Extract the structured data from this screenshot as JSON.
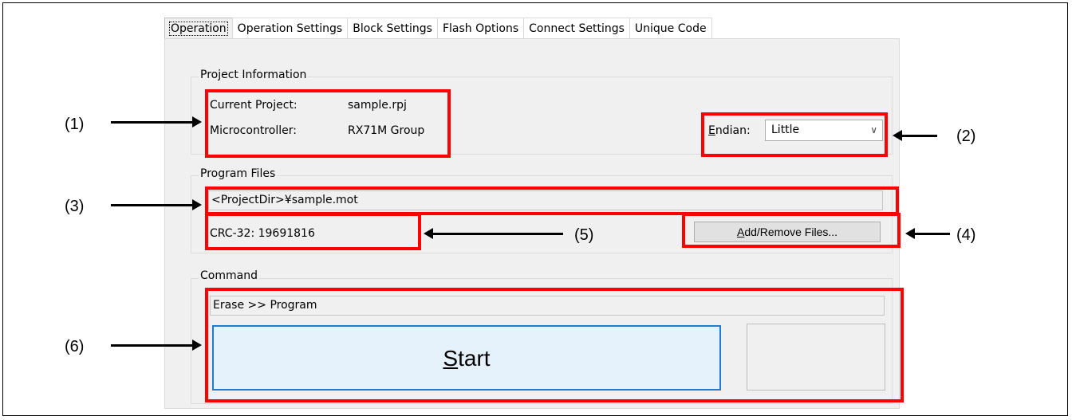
{
  "tabs": [
    {
      "label": "Operation",
      "active": true
    },
    {
      "label": "Operation Settings",
      "active": false
    },
    {
      "label": "Block Settings",
      "active": false
    },
    {
      "label": "Flash Options",
      "active": false
    },
    {
      "label": "Connect Settings",
      "active": false
    },
    {
      "label": "Unique Code",
      "active": false
    }
  ],
  "project_info": {
    "title": "Project Information",
    "current_project_label": "Current Project:",
    "current_project_value": "sample.rpj",
    "microcontroller_label": "Microcontroller:",
    "microcontroller_value": "RX71M Group",
    "endian_label_mnemonic": "E",
    "endian_label_rest": "ndian:",
    "endian_value": "Little"
  },
  "program_files": {
    "title": "Program Files",
    "file_path": "<ProjectDir>¥sample.mot",
    "crc": "CRC-32: 19691816",
    "add_remove_mnemonic": "A",
    "add_remove_rest": "dd/Remove Files..."
  },
  "command": {
    "title": "Command",
    "command_text": "Erase >> Program",
    "start_mnemonic": "S",
    "start_rest": "tart"
  },
  "annotations": {
    "l1": "(1)",
    "l2": "(2)",
    "l3": "(3)",
    "l4": "(4)",
    "l5": "(5)",
    "l6": "(6)"
  },
  "colors": {
    "annotation_box": "#ff0000",
    "start_button_border": "#1e7bd6",
    "panel_background": "#f0f0f0"
  },
  "icons": {
    "endian_dropdown": "chevron-down-icon"
  }
}
